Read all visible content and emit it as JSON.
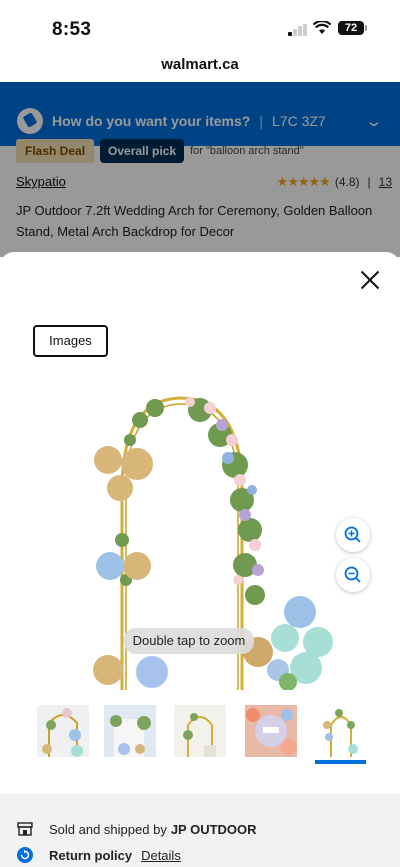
{
  "status": {
    "time": "8:53",
    "battery": "72"
  },
  "browser": {
    "domain": "walmart.ca"
  },
  "fulfillment": {
    "question": "How do you want your items?",
    "postal": "L7C 3Z7"
  },
  "badges": {
    "flash": "Flash Deal",
    "pick": "Overall pick",
    "query": "for \"balloon arch stand\""
  },
  "product": {
    "seller": "Skypatio",
    "rating": "(4.8)",
    "review_count": "13",
    "title": "JP Outdoor 7.2ft Wedding Arch for Ceremony, Golden Balloon Stand, Metal Arch Backdrop for Decor"
  },
  "sheet": {
    "tab_label": "Images",
    "hint": "Double tap to zoom",
    "thumbnail_count": 5,
    "active_thumbnail": 5
  },
  "footer": {
    "sold_by_prefix": "Sold and shipped by",
    "seller": "JP OUTDOOR",
    "return_label": "Return policy",
    "details": "Details"
  },
  "colors": {
    "brand_blue": "#0071dc",
    "navy": "#002d58",
    "flash_bg": "#f6e3b8",
    "star": "#f5a623"
  },
  "icons": [
    "signal-icon",
    "wifi-icon",
    "battery-icon",
    "fulfillment-icon",
    "chevron-down-icon",
    "star-icon",
    "close-icon",
    "zoom-in-icon",
    "zoom-out-icon",
    "store-icon",
    "return-icon"
  ]
}
